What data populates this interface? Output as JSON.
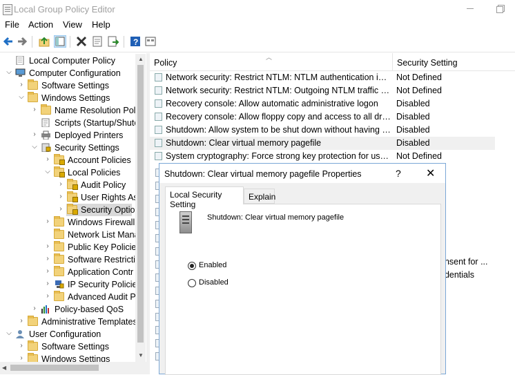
{
  "window": {
    "title": "Local Group Policy Editor"
  },
  "menu": {
    "items": [
      "File",
      "Action",
      "View",
      "Help"
    ]
  },
  "toolbar": {
    "icons": [
      "back-arrow-icon",
      "forward-arrow-icon",
      "up-folder-icon",
      "show-hide-tree-icon",
      "delete-icon",
      "properties-icon",
      "export-list-icon",
      "help-icon",
      "view-icon"
    ]
  },
  "tree": {
    "items": [
      {
        "label": "Local Computer Policy",
        "level": 0,
        "chevron": "",
        "icon": "policy-doc-icon"
      },
      {
        "label": "Computer Configuration",
        "level": 0,
        "chevron": "open",
        "icon": "computer-icon"
      },
      {
        "label": "Software Settings",
        "level": 1,
        "chevron": "closed",
        "icon": "folder-icon"
      },
      {
        "label": "Windows Settings",
        "level": 1,
        "chevron": "open",
        "icon": "folder-icon"
      },
      {
        "label": "Name Resolution Poli",
        "level": 2,
        "chevron": "closed",
        "icon": "folder-icon"
      },
      {
        "label": "Scripts (Startup/Shutc",
        "level": 2,
        "chevron": "",
        "icon": "script-icon"
      },
      {
        "label": "Deployed Printers",
        "level": 2,
        "chevron": "closed",
        "icon": "printer-icon"
      },
      {
        "label": "Security Settings",
        "level": 2,
        "chevron": "open",
        "icon": "shield-icon"
      },
      {
        "label": "Account Policies",
        "level": 3,
        "chevron": "closed",
        "icon": "folder-lock-icon"
      },
      {
        "label": "Local Policies",
        "level": 3,
        "chevron": "open",
        "icon": "folder-lock-icon"
      },
      {
        "label": "Audit Policy",
        "level": 4,
        "chevron": "closed",
        "icon": "folder-lock-icon"
      },
      {
        "label": "User Rights As",
        "level": 4,
        "chevron": "closed",
        "icon": "folder-lock-icon"
      },
      {
        "label": "Security Optio",
        "level": 4,
        "chevron": "closed",
        "icon": "folder-lock-icon",
        "selected": true
      },
      {
        "label": "Windows Firewall",
        "level": 3,
        "chevron": "closed",
        "icon": "folder-icon"
      },
      {
        "label": "Network List Mana",
        "level": 3,
        "chevron": "",
        "icon": "folder-icon"
      },
      {
        "label": "Public Key Policies",
        "level": 3,
        "chevron": "closed",
        "icon": "folder-icon"
      },
      {
        "label": "Software Restrictic",
        "level": 3,
        "chevron": "closed",
        "icon": "folder-icon"
      },
      {
        "label": "Application Contr",
        "level": 3,
        "chevron": "closed",
        "icon": "folder-icon"
      },
      {
        "label": "IP Security Policies",
        "level": 3,
        "chevron": "closed",
        "icon": "ip-security-icon"
      },
      {
        "label": "Advanced Audit P",
        "level": 3,
        "chevron": "closed",
        "icon": "folder-icon"
      },
      {
        "label": "Policy-based QoS",
        "level": 2,
        "chevron": "closed",
        "icon": "qos-chart-icon"
      },
      {
        "label": "Administrative Templates",
        "level": 1,
        "chevron": "closed",
        "icon": "folder-icon"
      },
      {
        "label": "User Configuration",
        "level": 0,
        "chevron": "open",
        "icon": "user-icon"
      },
      {
        "label": "Software Settings",
        "level": 1,
        "chevron": "closed",
        "icon": "folder-icon"
      },
      {
        "label": "Windows Settings",
        "level": 1,
        "chevron": "closed",
        "icon": "folder-icon"
      }
    ]
  },
  "list": {
    "columns": {
      "policy": "Policy",
      "setting": "Security Setting"
    },
    "rows": [
      {
        "policy": "Network security: Restrict NTLM: NTLM authentication in th...",
        "setting": "Not Defined"
      },
      {
        "policy": "Network security: Restrict NTLM: Outgoing NTLM traffic to ...",
        "setting": "Not Defined"
      },
      {
        "policy": "Recovery console: Allow automatic administrative logon",
        "setting": "Disabled"
      },
      {
        "policy": "Recovery console: Allow floppy copy and access to all drives...",
        "setting": "Disabled"
      },
      {
        "policy": "Shutdown: Allow system to be shut down without having to...",
        "setting": "Disabled"
      },
      {
        "policy": "Shutdown: Clear virtual memory pagefile",
        "setting": "Disabled",
        "highlighted": true
      },
      {
        "policy": "System cryptography: Force strong key protection for user k...",
        "setting": "Not Defined"
      }
    ],
    "obscured_fragments": [
      "onsent for ...",
      "edentials"
    ]
  },
  "dialog": {
    "title": "Shutdown: Clear virtual memory pagefile Properties",
    "help": "?",
    "close": "✕",
    "tabs": [
      "Local Security Setting",
      "Explain"
    ],
    "policy_name": "Shutdown: Clear virtual memory pagefile",
    "options": [
      {
        "label": "Enabled",
        "checked": true
      },
      {
        "label": "Disabled",
        "checked": false
      }
    ]
  }
}
